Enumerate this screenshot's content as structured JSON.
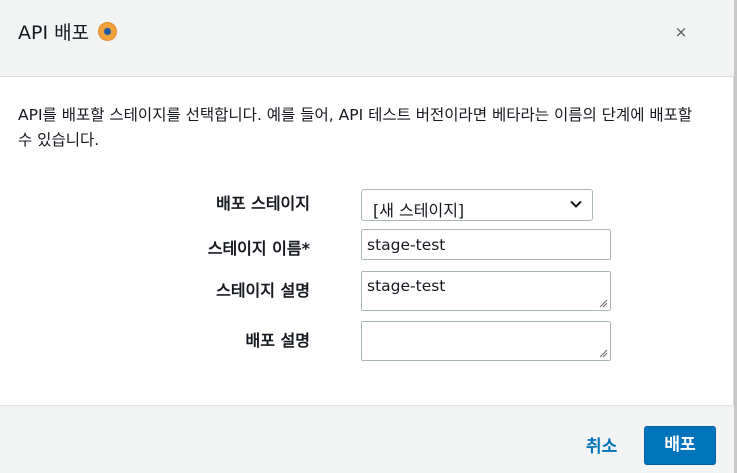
{
  "dialog": {
    "title": "API 배포",
    "close_symbol": "×"
  },
  "description": "API를 배포할 스테이지를 선택합니다. 예를 들어, API 테스트 버전이라면 베타라는 이름의 단계에 배포할 수 있습니다.",
  "form": {
    "stage_label": "배포 스테이지",
    "stage_selected": "[새 스테이지]",
    "stage_name_label": "스테이지 이름*",
    "stage_name_value": "stage-test",
    "stage_desc_label": "스테이지 설명",
    "stage_desc_value": "stage-test",
    "deploy_desc_label": "배포 설명",
    "deploy_desc_value": ""
  },
  "footer": {
    "cancel_label": "취소",
    "deploy_label": "배포"
  },
  "colors": {
    "accent": "#0073bb",
    "header_bg": "#f2f3f3",
    "info_icon": "#f0a23a"
  }
}
